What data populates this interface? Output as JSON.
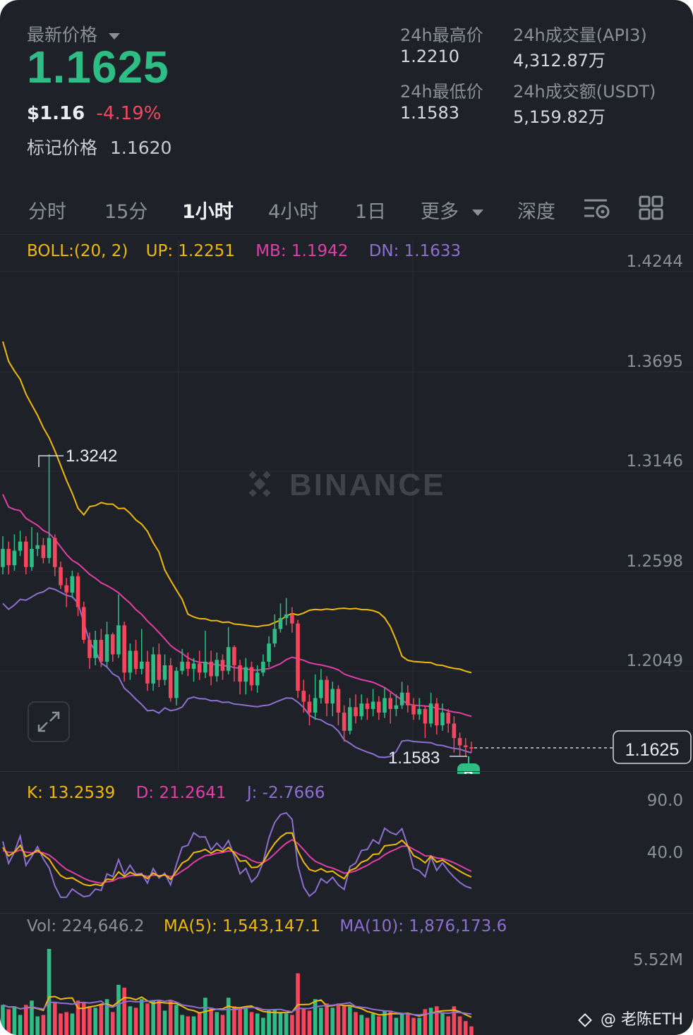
{
  "header": {
    "price_label": "最新价格",
    "last_price": "1.1625",
    "usd_price": "$1.16",
    "change_pct": "-4.19%",
    "mark_price_label": "标记价格",
    "mark_price": "1.1620"
  },
  "stats": {
    "high_label": "24h最高价",
    "high": "1.2210",
    "low_label": "24h最低价",
    "low": "1.1583",
    "vol_label": "24h成交量(API3)",
    "vol": "4,312.87万",
    "turnover_label": "24h成交额(USDT)",
    "turnover": "5,159.82万"
  },
  "tabs": [
    {
      "label": "分时"
    },
    {
      "label": "15分"
    },
    {
      "label": "1小时",
      "active": true
    },
    {
      "label": "4小时"
    },
    {
      "label": "1日"
    },
    {
      "label": "更多"
    },
    {
      "label": "深度"
    }
  ],
  "boll": {
    "label": "BOLL:(20, 2)",
    "up_label": "UP:",
    "up": "1.2251",
    "mb_label": "MB:",
    "mb": "1.1942",
    "dn_label": "DN:",
    "dn": "1.1633"
  },
  "price_axis": [
    "1.4244",
    "1.3695",
    "1.3146",
    "1.2598",
    "1.2049"
  ],
  "chart": {
    "watermark": "BINANCE",
    "high_marker": "1.3242",
    "low_marker": "1.1583",
    "current_price_tag": "1.1625",
    "buy_badge": "B"
  },
  "kdj": {
    "k_label": "K:",
    "k": "13.2539",
    "d_label": "D:",
    "d": "21.2641",
    "j_label": "J:",
    "j": "-2.7666",
    "axis": [
      "90.0",
      "40.0"
    ]
  },
  "volume": {
    "vol_label": "Vol:",
    "vol": "224,646.2",
    "ma5_label": "MA(5):",
    "ma5": "1,543,147.1",
    "ma10_label": "MA(10):",
    "ma10": "1,876,173.6",
    "axis_max": "5.52M"
  },
  "footer": {
    "watermark_user": "@ 老陈ETH"
  },
  "colors": {
    "up": "#2ebd85",
    "down": "#f6465d",
    "boll_up": "#f0b90b",
    "boll_mb": "#e03fa8",
    "boll_dn": "#8d6fd1",
    "background": "#1e2128"
  },
  "chart_data": {
    "type": "candlestick",
    "ylim": [
      1.15,
      1.44
    ],
    "candles": [
      [
        1.262,
        1.272,
        1.279,
        1.258
      ],
      [
        1.272,
        1.263,
        1.276,
        1.258
      ],
      [
        1.263,
        1.271,
        1.28,
        1.26
      ],
      [
        1.271,
        1.276,
        1.282,
        1.268
      ],
      [
        1.276,
        1.262,
        1.279,
        1.258
      ],
      [
        1.262,
        1.272,
        1.284,
        1.26
      ],
      [
        1.272,
        1.274,
        1.281,
        1.268
      ],
      [
        1.274,
        1.267,
        1.278,
        1.264
      ],
      [
        1.267,
        1.278,
        1.324,
        1.264
      ],
      [
        1.278,
        1.262,
        1.28,
        1.257
      ],
      [
        1.262,
        1.252,
        1.265,
        1.25
      ],
      [
        1.252,
        1.248,
        1.256,
        1.24
      ],
      [
        1.248,
        1.257,
        1.26,
        1.245
      ],
      [
        1.257,
        1.24,
        1.259,
        1.235
      ],
      [
        1.24,
        1.222,
        1.243,
        1.22
      ],
      [
        1.222,
        1.212,
        1.226,
        1.206
      ],
      [
        1.212,
        1.222,
        1.227,
        1.208
      ],
      [
        1.222,
        1.21,
        1.228,
        1.207
      ],
      [
        1.21,
        1.225,
        1.232,
        1.207
      ],
      [
        1.225,
        1.214,
        1.226,
        1.21
      ],
      [
        1.214,
        1.23,
        1.247,
        1.212
      ],
      [
        1.23,
        1.204,
        1.232,
        1.199
      ],
      [
        1.204,
        1.216,
        1.22,
        1.2
      ],
      [
        1.216,
        1.206,
        1.222,
        1.203
      ],
      [
        1.206,
        1.21,
        1.228,
        1.203
      ],
      [
        1.21,
        1.198,
        1.216,
        1.194
      ],
      [
        1.198,
        1.214,
        1.218,
        1.194
      ],
      [
        1.214,
        1.2,
        1.22,
        1.196
      ],
      [
        1.2,
        1.208,
        1.214,
        1.197
      ],
      [
        1.208,
        1.19,
        1.212,
        1.188
      ],
      [
        1.19,
        1.205,
        1.207,
        1.186
      ],
      [
        1.205,
        1.21,
        1.217,
        1.203
      ],
      [
        1.21,
        1.206,
        1.215,
        1.202
      ],
      [
        1.206,
        1.209,
        1.212,
        1.199
      ],
      [
        1.209,
        1.204,
        1.216,
        1.2
      ],
      [
        1.204,
        1.21,
        1.227,
        1.201
      ],
      [
        1.21,
        1.202,
        1.216,
        1.197
      ],
      [
        1.202,
        1.211,
        1.215,
        1.199
      ],
      [
        1.211,
        1.205,
        1.214,
        1.2
      ],
      [
        1.205,
        1.218,
        1.229,
        1.203
      ],
      [
        1.218,
        1.208,
        1.219,
        1.199
      ],
      [
        1.208,
        1.199,
        1.211,
        1.192
      ],
      [
        1.199,
        1.207,
        1.212,
        1.192
      ],
      [
        1.207,
        1.197,
        1.21,
        1.194
      ],
      [
        1.197,
        1.204,
        1.208,
        1.193
      ],
      [
        1.204,
        1.21,
        1.214,
        1.202
      ],
      [
        1.21,
        1.22,
        1.224,
        1.207
      ],
      [
        1.22,
        1.228,
        1.236,
        1.218
      ],
      [
        1.228,
        1.234,
        1.242,
        1.226
      ],
      [
        1.234,
        1.236,
        1.245,
        1.23
      ],
      [
        1.236,
        1.231,
        1.24,
        1.226
      ],
      [
        1.231,
        1.194,
        1.233,
        1.19
      ],
      [
        1.194,
        1.188,
        1.2,
        1.182
      ],
      [
        1.188,
        1.182,
        1.192,
        1.175
      ],
      [
        1.182,
        1.19,
        1.203,
        1.178
      ],
      [
        1.19,
        1.2,
        1.206,
        1.187
      ],
      [
        1.2,
        1.187,
        1.202,
        1.18
      ],
      [
        1.187,
        1.195,
        1.199,
        1.18
      ],
      [
        1.195,
        1.182,
        1.197,
        1.175
      ],
      [
        1.182,
        1.172,
        1.186,
        1.166
      ],
      [
        1.172,
        1.185,
        1.19,
        1.17
      ],
      [
        1.185,
        1.18,
        1.192,
        1.176
      ],
      [
        1.18,
        1.187,
        1.192,
        1.178
      ],
      [
        1.187,
        1.184,
        1.19,
        1.178
      ],
      [
        1.184,
        1.188,
        1.195,
        1.18
      ],
      [
        1.188,
        1.182,
        1.191,
        1.178
      ],
      [
        1.182,
        1.19,
        1.196,
        1.179
      ],
      [
        1.19,
        1.184,
        1.193,
        1.176
      ],
      [
        1.184,
        1.186,
        1.192,
        1.18
      ],
      [
        1.186,
        1.193,
        1.199,
        1.184
      ],
      [
        1.193,
        1.186,
        1.197,
        1.182
      ],
      [
        1.186,
        1.181,
        1.19,
        1.178
      ],
      [
        1.181,
        1.184,
        1.19,
        1.178
      ],
      [
        1.184,
        1.176,
        1.186,
        1.168
      ],
      [
        1.176,
        1.187,
        1.193,
        1.174
      ],
      [
        1.187,
        1.175,
        1.19,
        1.17
      ],
      [
        1.175,
        1.182,
        1.187,
        1.172
      ],
      [
        1.182,
        1.176,
        1.184,
        1.171
      ],
      [
        1.176,
        1.168,
        1.18,
        1.16
      ],
      [
        1.168,
        1.164,
        1.171,
        1.158
      ],
      [
        1.164,
        1.163,
        1.168,
        1.1583
      ],
      [
        1.163,
        1.1625,
        1.166,
        1.16
      ]
    ]
  }
}
